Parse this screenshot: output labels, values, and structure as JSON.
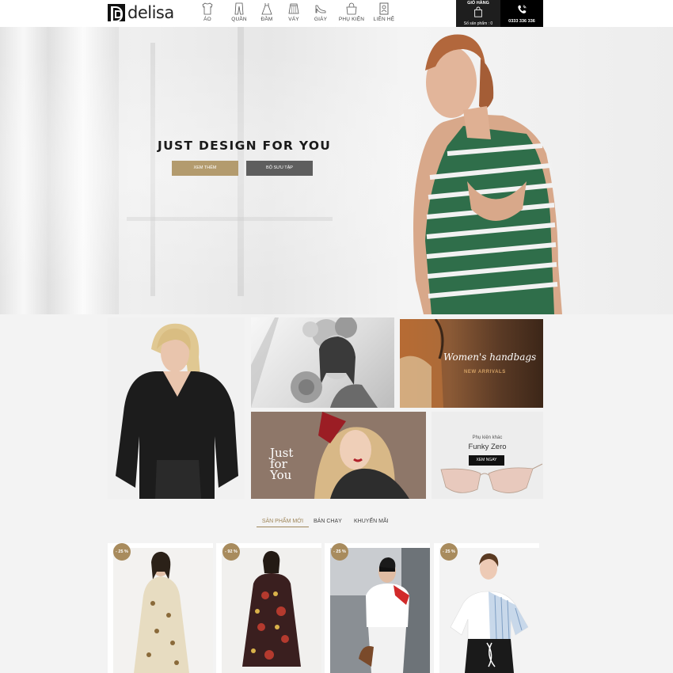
{
  "header": {
    "logo_text": "delisa",
    "nav": [
      {
        "label": "ÁO",
        "icon": "shirt-icon"
      },
      {
        "label": "QUẦN",
        "icon": "pants-icon"
      },
      {
        "label": "ĐẦM",
        "icon": "dress-icon"
      },
      {
        "label": "VÁY",
        "icon": "skirt-icon"
      },
      {
        "label": "GIÀY",
        "icon": "shoe-icon"
      },
      {
        "label": "PHỤ KIỆN",
        "icon": "bag-icon"
      },
      {
        "label": "LIÊN HỆ",
        "icon": "contact-book-icon"
      }
    ],
    "cart": {
      "title": "GIỎ HÀNG",
      "count_text": "Số sản phẩm : 0"
    },
    "phone": {
      "number": "0333 336 336"
    }
  },
  "hero": {
    "title": "JUST DESIGN FOR YOU",
    "primary_button": "XEM THÊM",
    "secondary_button": "BỘ SƯU TẬP"
  },
  "banners": {
    "handbags_title": "Women's handbags",
    "handbags_subtitle": "NEW ARRIVALS",
    "just_for_you": "Just for You",
    "accessory_label": "Phụ kiện khác",
    "accessory_title": "Funky Zero",
    "accessory_button": "XEM NGAY"
  },
  "tabs": [
    "SẢN PHẨM MỚI",
    "BÁN CHẠY",
    "KHUYẾN MÃI"
  ],
  "products": [
    {
      "discount": "- 25 %"
    },
    {
      "discount": "- 92 %"
    },
    {
      "discount": "- 25 %"
    },
    {
      "discount": "- 25 %"
    }
  ],
  "colors": {
    "accent": "#b39b6e",
    "dark": "#1e1e1e"
  }
}
